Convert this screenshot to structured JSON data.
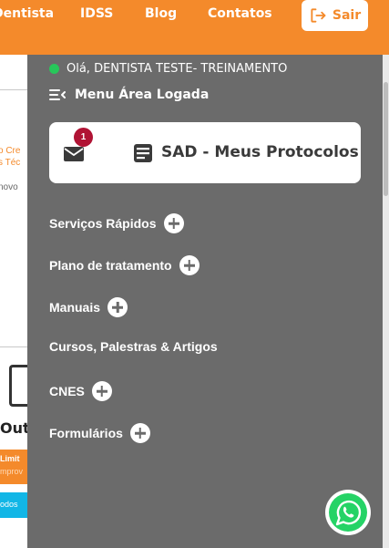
{
  "topnav": {
    "links": [
      "Dentista",
      "IDSS",
      "Blog",
      "Contatos"
    ],
    "logout_label": "Sair"
  },
  "background": {
    "orange_line_1": "o Cre",
    "orange_line_2": "s Téc",
    "gray_text": "novo",
    "month_partial": "Out",
    "bar_line_1": "Limit",
    "bar_line_2": "mprov",
    "cyan_text": "odos"
  },
  "panel": {
    "greeting": "Olá, DENTISTA TESTE- TREINAMENTO",
    "menu_title": "Menu Área Logada",
    "card": {
      "badge_count": "1",
      "label": "SAD - Meus Protocolos"
    },
    "items": [
      {
        "label": "Serviços Rápidos",
        "expandable": true
      },
      {
        "label": "Plano de tratamento",
        "expandable": true
      },
      {
        "label": "Manuais",
        "expandable": true
      },
      {
        "label": "Cursos, Palestras & Artigos",
        "expandable": false
      },
      {
        "label": "CNES",
        "expandable": true
      },
      {
        "label": "Formulários",
        "expandable": true
      }
    ]
  },
  "colors": {
    "brand_orange": "#f48a2b",
    "panel_gray": "#6b6b6b",
    "online_green": "#27c75a",
    "badge_red": "#b01334",
    "whatsapp_green": "#25d366"
  },
  "icons": {
    "logout": "logout-icon",
    "menu": "menu-collapse-icon",
    "mail": "envelope-icon",
    "protocol": "protocol-icon",
    "expand": "plus-circle-icon",
    "chat": "whatsapp-icon"
  }
}
